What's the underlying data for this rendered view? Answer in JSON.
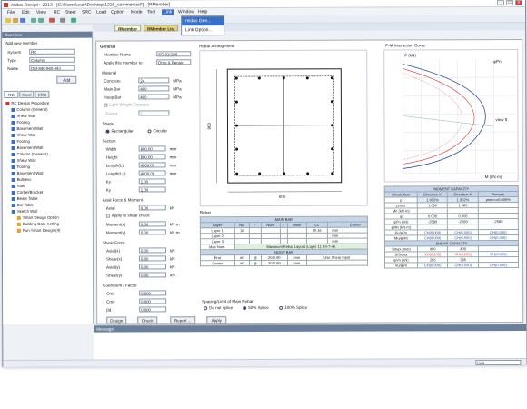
{
  "window": {
    "title": "midas Design+ 2013 - [C:\\Users\\user\\Desktop\\1229_commercial*] - [RMember]",
    "min": "_",
    "max": "□",
    "close": "×"
  },
  "menu": [
    "File",
    "Edit",
    "View",
    "RC",
    "Steel",
    "SRC",
    "Load",
    "Option",
    "Mode",
    "Tool",
    "Link",
    "Window",
    "Help"
  ],
  "link_menu": {
    "items": [
      "midas Gen...",
      "Link Option..."
    ]
  },
  "tabs": [
    "RMember",
    "RMember List"
  ],
  "overview": {
    "title": "Overview",
    "add_member": "Add new member",
    "system_label": "System",
    "system_value": "RC",
    "type_label": "Type",
    "type_value": "Column",
    "name_label": "Name",
    "name_value": "DM-840-940-843",
    "add_button": "Add",
    "tabs": [
      "RC",
      "Steel",
      "SRC"
    ],
    "tree": [
      "RC Design Procedure",
      "Column (General)",
      "Shear Wall",
      "Footing",
      "Basement Wall",
      "Shear Wall",
      "Footing",
      "Basement Wall",
      "Column (General)",
      "Shear Wall",
      "Footing",
      "Basement Wall",
      "Buttress",
      "Stair",
      "Corbel/Bracket",
      "Beam Table",
      "Bar Table",
      "Sketch Wall",
      "Smart Design Option",
      "Building Data Setting",
      "Run Smart Design (4)"
    ]
  },
  "general": {
    "title": "General",
    "member_name_label": "Member Name",
    "member_name": "SC-01(1M)",
    "apply_label": "Apply this member to",
    "apply_value": "Drag & Repair",
    "material_title": "Material",
    "concrete_label": "Concrete",
    "concrete_value": "24",
    "concrete_unit": "MPa",
    "mainbar_label": "Main Bar",
    "mainbar_value": "400",
    "mainbar_unit": "MPa",
    "hoop_label": "Hoop Bar",
    "hoop_value": "400",
    "hoop_unit": "MPa",
    "lw_label": "Light Weight Concrete",
    "factor_label": "Factor",
    "factor_value": "1"
  },
  "shape": {
    "title": "Shape",
    "rect": "Rectangular",
    "circ": "Circular"
  },
  "section": {
    "title": "Section",
    "rows": [
      {
        "label": "Width",
        "value": "800.00",
        "unit": "mm"
      },
      {
        "label": "Height",
        "value": "800.00",
        "unit": "mm"
      },
      {
        "label": "Length(L)",
        "value": "4000.00",
        "unit": "mm"
      },
      {
        "label": "Length(Lu)",
        "value": "4000.00",
        "unit": "mm"
      },
      {
        "label": "Kx",
        "value": "1.00",
        "unit": ""
      },
      {
        "label": "Ky",
        "value": "1.00",
        "unit": ""
      }
    ]
  },
  "axial": {
    "title": "Axial Force & Moment",
    "axial_label": "Axial",
    "axial_value": "0.00",
    "axial_unit": "kN",
    "apply_shear": "Apply to shear check",
    "mx_label": "Moment(x)",
    "mx_value": "0.00",
    "mx_unit": "kN·m",
    "my_label": "Moment(y)",
    "my_value": "0.00",
    "my_unit": "kN·m"
  },
  "shear": {
    "title": "Shear Force",
    "rows": [
      {
        "label": "Axial(x)",
        "value": "0.00",
        "unit": "kN"
      },
      {
        "label": "Shear(x)",
        "value": "0.00",
        "unit": "kN"
      },
      {
        "label": "Axial(y)",
        "value": "0.00",
        "unit": "kN"
      },
      {
        "label": "Shear(y)",
        "value": "0.00",
        "unit": "kN"
      }
    ]
  },
  "coef": {
    "title": "Coefficient / Factor",
    "rows": [
      {
        "label": "Cmx",
        "value": "0.000"
      },
      {
        "label": "Cmy",
        "value": "0.000"
      },
      {
        "label": "βd",
        "value": "0.000"
      }
    ]
  },
  "buttons": {
    "design": "Design",
    "check": "Check",
    "report": "Report ...",
    "apply": "Apply"
  },
  "rebar_arrangement": {
    "title": "Rebar Arrangement",
    "dim_width": "800",
    "dim_height": "800"
  },
  "pm_curve": {
    "title": "P-M Interaction Curve",
    "labels": [
      "P (kN)",
      "φPn",
      "M (kN·m)",
      "view 5"
    ]
  },
  "rebar": {
    "title": "Rebar",
    "main_bar": "MAIN BAR",
    "headers": [
      "Layer",
      "No.",
      "-",
      "Num",
      "-",
      "Main",
      "Cc",
      "",
      "Corner"
    ],
    "rows": [
      [
        "Layer 1",
        "16",
        "",
        "",
        "",
        "",
        "40.16",
        "mm",
        ""
      ],
      [
        "Layer 2",
        "",
        "",
        "",
        "",
        "",
        "",
        "mm",
        ""
      ],
      [
        "Layer 3",
        "",
        "",
        "",
        "",
        "",
        "",
        "mm",
        ""
      ]
    ],
    "max_num": "Max Num.",
    "max_text": "Maximum Rebar Layout (Layer 1): 24-7-46",
    "hoop_bar": "HOOP BAR",
    "hoop_rows": [
      [
        "End",
        "#0",
        "@",
        "20-0.90",
        "mm",
        "Use Shear Input"
      ],
      [
        "Center",
        "#0",
        "@",
        "20-0.90",
        "mm",
        ""
      ]
    ],
    "spacing_title": "Spacing/Limit of Main Rebar",
    "spacing_opts": [
      "Do not splice",
      "50% Splice",
      "100% Splice"
    ]
  },
  "moment_capacity": {
    "title": "MOMENT CAPACITY",
    "headers": [
      "Check Item",
      "Direction-X",
      "Direction-Y",
      "Remark"
    ],
    "rows": [
      [
        "ρ",
        "1.902%",
        "1.902%",
        "ρmin<=0.009%"
      ],
      [
        "ρmax",
        "1.080",
        "1.080",
        ""
      ],
      [
        "Mn (kN·m)",
        "",
        "",
        ""
      ],
      [
        "φ",
        "0.000",
        "0.000",
        ""
      ],
      [
        "φPn (kN)",
        "-2589",
        "-2589",
        "-2589"
      ],
      [
        "φMn (kN·m)",
        "",
        "",
        ""
      ],
      [
        "Pu/φPn",
        "CH(0.000)",
        "CH(0.000)",
        "CH(0.000)"
      ],
      [
        "Mu/φMn",
        "CH(0.000)",
        "CH(0.000)",
        "CH(0.000)"
      ]
    ],
    "shear_title": "SHEAR CAPACITY",
    "shear_rows": [
      [
        "Smax (mm)",
        "400",
        "400",
        ""
      ],
      [
        "S/Smax",
        "VH(0.205)",
        "VH(0.205)",
        "CH(0.000)"
      ],
      [
        "φVn (kN)",
        "265",
        "265",
        ""
      ],
      [
        "Vu/φVn",
        "CH(0.000)",
        "CH(0.000)",
        "CH(0.000)"
      ]
    ]
  },
  "message": {
    "title": "Message"
  },
  "status": {
    "unit": "Unit"
  },
  "colors": {
    "accent": "#3a6fc4",
    "panel_title": "#6b7f9c",
    "table_header": "#c6d4ec"
  }
}
